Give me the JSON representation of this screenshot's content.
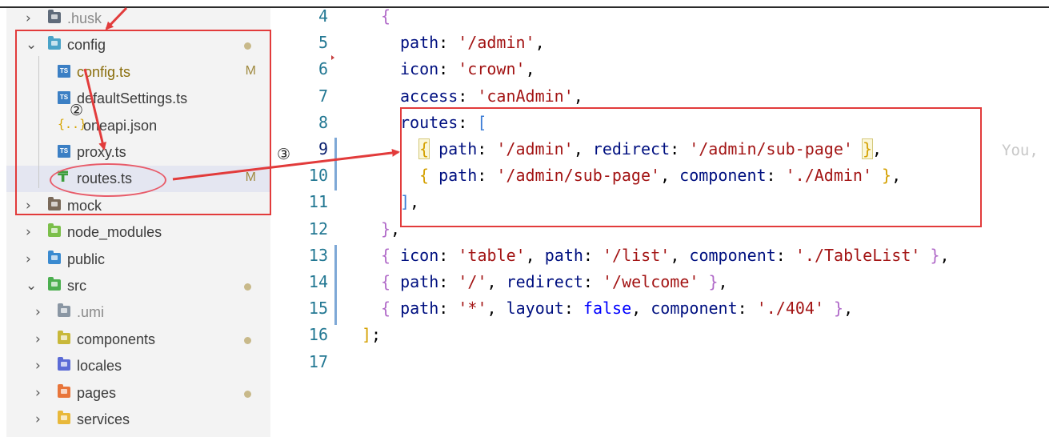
{
  "explorer": {
    "items": [
      {
        "label": ".husk",
        "chevron": "›",
        "indent": 0,
        "kind": "folder",
        "color": "#5f6b7a",
        "dim": true
      },
      {
        "label": "config",
        "chevron": "⌄",
        "indent": 0,
        "kind": "folder",
        "color": "#4aa3c8",
        "dot": true
      },
      {
        "label": "config.ts",
        "indent": 1,
        "kind": "ts",
        "badge": "M",
        "mod": true
      },
      {
        "label": "defaultSettings.ts",
        "indent": 1,
        "kind": "ts"
      },
      {
        "label": "oneapi.json",
        "indent": 1,
        "kind": "json"
      },
      {
        "label": "proxy.ts",
        "indent": 1,
        "kind": "ts"
      },
      {
        "label": "routes.ts",
        "indent": 1,
        "kind": "routes",
        "badge": "M",
        "selected": true
      },
      {
        "label": "mock",
        "chevron": "›",
        "indent": 0,
        "kind": "folder",
        "color": "#7a6a5a"
      },
      {
        "label": "node_modules",
        "chevron": "›",
        "indent": 0,
        "kind": "folder",
        "color": "#7bbf4a"
      },
      {
        "label": "public",
        "chevron": "›",
        "indent": 0,
        "kind": "folder",
        "color": "#3a8ad0"
      },
      {
        "label": "src",
        "chevron": "⌄",
        "indent": 0,
        "kind": "folder",
        "color": "#4caf50",
        "dot": true
      },
      {
        "label": ".umi",
        "chevron": "›",
        "indent": 1,
        "kind": "folder",
        "color": "#8a96a3",
        "dim": true
      },
      {
        "label": "components",
        "chevron": "›",
        "indent": 1,
        "kind": "folder",
        "color": "#c8b83a",
        "dot": true
      },
      {
        "label": "locales",
        "chevron": "›",
        "indent": 1,
        "kind": "folder",
        "color": "#5b6bd6"
      },
      {
        "label": "pages",
        "chevron": "›",
        "indent": 1,
        "kind": "folder",
        "color": "#e8753a",
        "dot": true
      },
      {
        "label": "services",
        "chevron": "›",
        "indent": 1,
        "kind": "folder",
        "color": "#e8b83a"
      }
    ],
    "ts_icon_text": "TS",
    "json_icon_text": "{..}",
    "routes_icon_text": "₸"
  },
  "editor": {
    "lines": [
      {
        "n": "4",
        "tokens": [
          [
            "br1",
            "{"
          ]
        ],
        "indent": 1
      },
      {
        "n": "5",
        "tokens": [
          [
            "key",
            "path"
          ],
          [
            "p",
            ": "
          ],
          [
            "str",
            "'/admin'"
          ],
          [
            "p",
            ","
          ]
        ],
        "indent": 2
      },
      {
        "n": "6",
        "tokens": [
          [
            "key",
            "icon"
          ],
          [
            "p",
            ": "
          ],
          [
            "str",
            "'crown'"
          ],
          [
            "p",
            ","
          ]
        ],
        "indent": 2
      },
      {
        "n": "7",
        "tokens": [
          [
            "key",
            "access"
          ],
          [
            "p",
            ": "
          ],
          [
            "str",
            "'canAdmin'"
          ],
          [
            "p",
            ","
          ]
        ],
        "indent": 2
      },
      {
        "n": "8",
        "tokens": [
          [
            "key",
            "routes"
          ],
          [
            "p",
            ": "
          ],
          [
            "br2",
            "["
          ]
        ],
        "indent": 2
      },
      {
        "n": "9",
        "tokens": [
          [
            "br3h",
            "{"
          ],
          [
            "p",
            " "
          ],
          [
            "key",
            "path"
          ],
          [
            "p",
            ": "
          ],
          [
            "str",
            "'/admin'"
          ],
          [
            "p",
            ", "
          ],
          [
            "key",
            "redirect"
          ],
          [
            "p",
            ": "
          ],
          [
            "str",
            "'/admin/sub-page'"
          ],
          [
            "p",
            " "
          ],
          [
            "br3h",
            "}"
          ],
          [
            "p",
            ","
          ]
        ],
        "indent": 3,
        "current": true
      },
      {
        "n": "10",
        "tokens": [
          [
            "br3",
            "{"
          ],
          [
            "p",
            " "
          ],
          [
            "key",
            "path"
          ],
          [
            "p",
            ": "
          ],
          [
            "str",
            "'/admin/sub-page'"
          ],
          [
            "p",
            ", "
          ],
          [
            "key",
            "component"
          ],
          [
            "p",
            ": "
          ],
          [
            "str",
            "'./Admin'"
          ],
          [
            "p",
            " "
          ],
          [
            "br3",
            "}"
          ],
          [
            "p",
            ","
          ]
        ],
        "indent": 3
      },
      {
        "n": "11",
        "tokens": [
          [
            "br2",
            "]"
          ],
          [
            "p",
            ","
          ]
        ],
        "indent": 2
      },
      {
        "n": "12",
        "tokens": [
          [
            "br1",
            "}"
          ],
          [
            "p",
            ","
          ]
        ],
        "indent": 1
      },
      {
        "n": "13",
        "tokens": [
          [
            "br1",
            "{"
          ],
          [
            "p",
            " "
          ],
          [
            "key",
            "icon"
          ],
          [
            "p",
            ": "
          ],
          [
            "str",
            "'table'"
          ],
          [
            "p",
            ", "
          ],
          [
            "key",
            "path"
          ],
          [
            "p",
            ": "
          ],
          [
            "str",
            "'/list'"
          ],
          [
            "p",
            ", "
          ],
          [
            "key",
            "component"
          ],
          [
            "p",
            ": "
          ],
          [
            "str",
            "'./TableList'"
          ],
          [
            "p",
            " "
          ],
          [
            "br1",
            "}"
          ],
          [
            "p",
            ","
          ]
        ],
        "indent": 1
      },
      {
        "n": "14",
        "tokens": [
          [
            "br1",
            "{"
          ],
          [
            "p",
            " "
          ],
          [
            "key",
            "path"
          ],
          [
            "p",
            ": "
          ],
          [
            "str",
            "'/'"
          ],
          [
            "p",
            ", "
          ],
          [
            "key",
            "redirect"
          ],
          [
            "p",
            ": "
          ],
          [
            "str",
            "'/welcome'"
          ],
          [
            "p",
            " "
          ],
          [
            "br1",
            "}"
          ],
          [
            "p",
            ","
          ]
        ],
        "indent": 1
      },
      {
        "n": "15",
        "tokens": [
          [
            "br1",
            "{"
          ],
          [
            "p",
            " "
          ],
          [
            "key",
            "path"
          ],
          [
            "p",
            ": "
          ],
          [
            "str",
            "'*'"
          ],
          [
            "p",
            ", "
          ],
          [
            "key",
            "layout"
          ],
          [
            "p",
            ": "
          ],
          [
            "kw",
            "false"
          ],
          [
            "p",
            ", "
          ],
          [
            "key",
            "component"
          ],
          [
            "p",
            ": "
          ],
          [
            "str",
            "'./404'"
          ],
          [
            "p",
            " "
          ],
          [
            "br1",
            "}"
          ],
          [
            "p",
            ","
          ]
        ],
        "indent": 1
      },
      {
        "n": "16",
        "tokens": [
          [
            "br3",
            "]"
          ],
          [
            "p",
            ";"
          ]
        ],
        "indent": 0
      },
      {
        "n": "17",
        "tokens": [],
        "indent": 0
      }
    ],
    "blame_ghost": "You,"
  },
  "annotations": {
    "step2": "②",
    "step3": "③"
  },
  "colors": {
    "annotation_red": "#e23b3b",
    "sidebar_bg": "#f3f3f3",
    "selection_bg": "#e4e6f1"
  }
}
